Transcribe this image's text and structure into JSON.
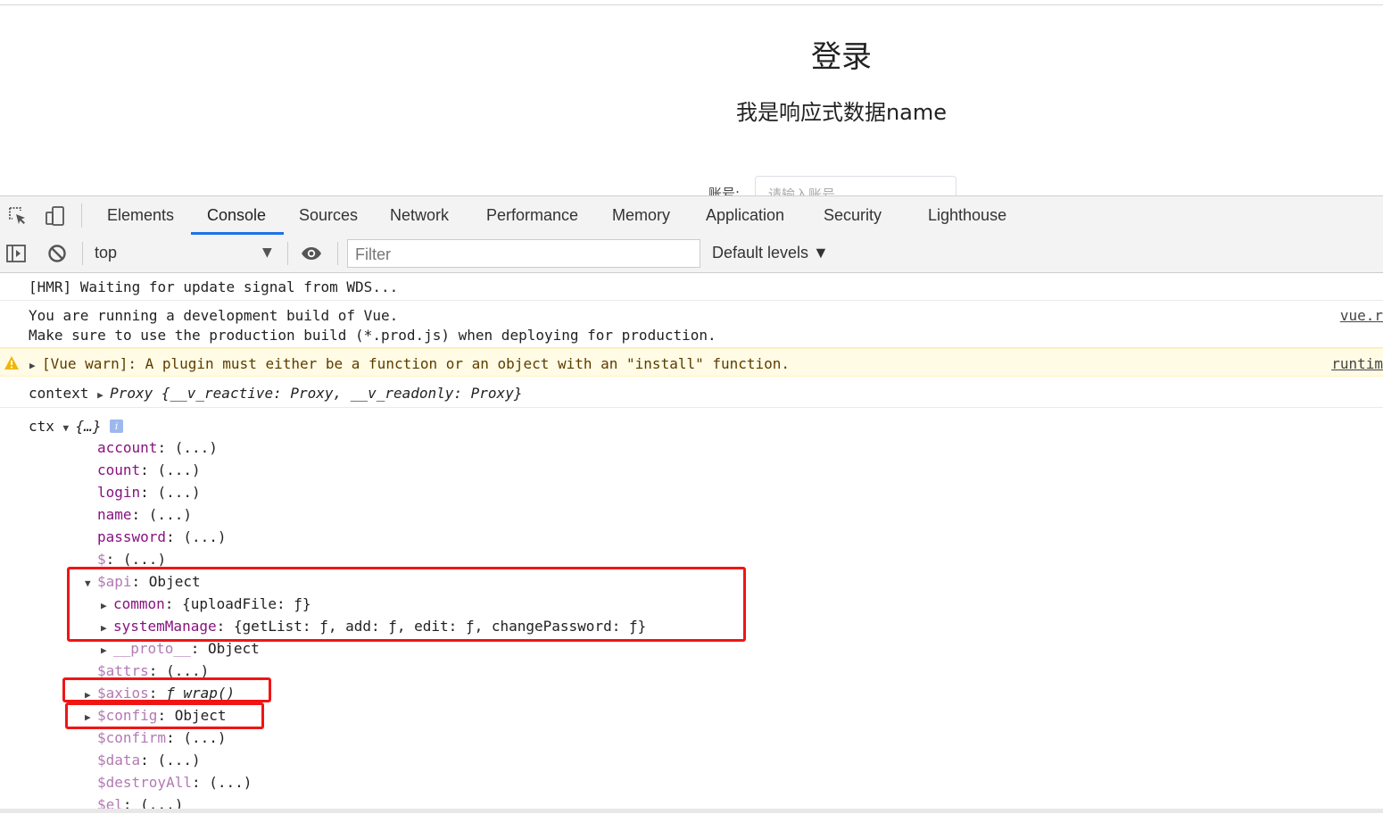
{
  "page": {
    "title": "登录",
    "subtitle": "我是响应式数据name",
    "account_label": "账号:",
    "account_placeholder": "请输入账号"
  },
  "devtools": {
    "tabs": [
      "Elements",
      "Console",
      "Sources",
      "Network",
      "Performance",
      "Memory",
      "Application",
      "Security",
      "Lighthouse"
    ],
    "active_tab": "Console",
    "context": "top",
    "filter_placeholder": "Filter",
    "levels": "Default levels ▼"
  },
  "console": {
    "hmr": "[HMR] Waiting for update signal from WDS...",
    "vue_dev_line1": "You are running a development build of Vue.",
    "vue_dev_line2": "Make sure to use the production build (*.prod.js) when deploying for production.",
    "vue_dev_src": "vue.r",
    "warn_text": "[Vue warn]: A plugin must either be a function or an object with an \"install\" function.",
    "warn_src": "runtim",
    "context_label": "context",
    "context_value": "Proxy {__v_reactive: Proxy, __v_readonly: Proxy}",
    "ctx_label": "ctx",
    "ctx_value": "{…}",
    "props": [
      {
        "key": "account",
        "val": ": (...)"
      },
      {
        "key": "count",
        "val": ": (...)"
      },
      {
        "key": "login",
        "val": ": (...)"
      },
      {
        "key": "name",
        "val": ": (...)"
      },
      {
        "key": "password",
        "val": ": (...)"
      },
      {
        "key": "$",
        "val": ": (...)"
      }
    ],
    "api_key": "$api",
    "api_val": ": Object",
    "common_key": "common",
    "common_val": ": {uploadFile: ƒ}",
    "system_key": "systemManage",
    "system_val": ": {getList: ƒ, add: ƒ, edit: ƒ, changePassword: ƒ}",
    "proto_key": "__proto__",
    "proto_val": ": Object",
    "attrs_key": "$attrs",
    "attrs_val": ": (...)",
    "axios_key": "$axios",
    "axios_val": "ƒ wrap()",
    "config_key": "$config",
    "config_val": ": Object",
    "tail_props": [
      {
        "key": "$confirm",
        "val": ": (...)"
      },
      {
        "key": "$data",
        "val": ": (...)"
      },
      {
        "key": "$destroyAll",
        "val": ": (...)"
      },
      {
        "key": "$el",
        "val": ": (...)"
      }
    ]
  },
  "colors": {
    "highlight": "#f01515",
    "accent": "#1a73e8",
    "warning_bg": "#fffbe5"
  },
  "icons": [
    "inspect-icon",
    "device-toggle-icon",
    "sidebar-toggle-icon",
    "clear-console-icon",
    "eye-icon",
    "warning-icon",
    "info-icon"
  ]
}
